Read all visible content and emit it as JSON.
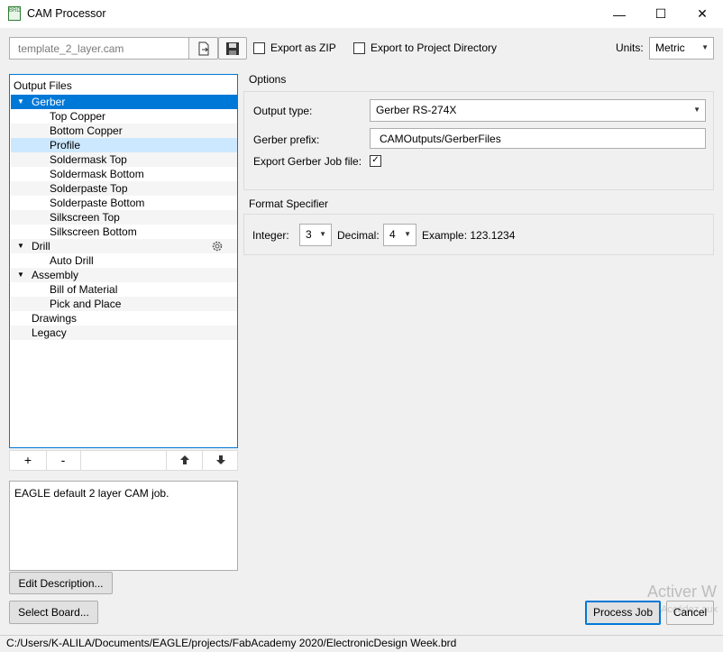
{
  "window": {
    "title": "CAM Processor",
    "app_icon": "BRD",
    "minimize": "—",
    "maximize": "☐",
    "close": "✕"
  },
  "toolbar": {
    "job_file": "template_2_layer.cam",
    "export_zip_label": "Export as ZIP",
    "export_project_label": "Export to Project Directory",
    "units_label": "Units:",
    "units_value": "Metric"
  },
  "output_files": {
    "header": "Output Files",
    "gerber": "Gerber",
    "gerber_items": [
      "Top Copper",
      "Bottom Copper",
      "Profile",
      "Soldermask Top",
      "Soldermask Bottom",
      "Solderpaste Top",
      "Solderpaste Bottom",
      "Silkscreen Top",
      "Silkscreen Bottom"
    ],
    "drill": "Drill",
    "drill_items": [
      "Auto Drill"
    ],
    "assembly": "Assembly",
    "assembly_items": [
      "Bill of Material",
      "Pick and Place"
    ],
    "drawings": "Drawings",
    "legacy": "Legacy",
    "add": "+",
    "remove": "-"
  },
  "description": {
    "text": "EAGLE default 2 layer CAM job.",
    "edit_button": "Edit Description..."
  },
  "options": {
    "header": "Options",
    "output_type_label": "Output type:",
    "output_type_value": "Gerber RS-274X",
    "gerber_prefix_label": "Gerber prefix:",
    "gerber_prefix_value": "CAMOutputs/GerberFiles",
    "export_job_label": "Export Gerber Job file:",
    "export_job_checked": true
  },
  "format": {
    "header": "Format Specifier",
    "integer_label": "Integer:",
    "integer_value": "3",
    "decimal_label": "Decimal:",
    "decimal_value": "4",
    "example": "Example: 123.1234"
  },
  "footer": {
    "select_board": "Select Board...",
    "process_job": "Process Job",
    "cancel": "Cancel",
    "watermark_1": "Activer W",
    "watermark_2": "Accédez aux",
    "status_path": "C:/Users/K-ALILA/Documents/EAGLE/projects/FabAcademy 2020/ElectronicDesign Week.brd"
  }
}
